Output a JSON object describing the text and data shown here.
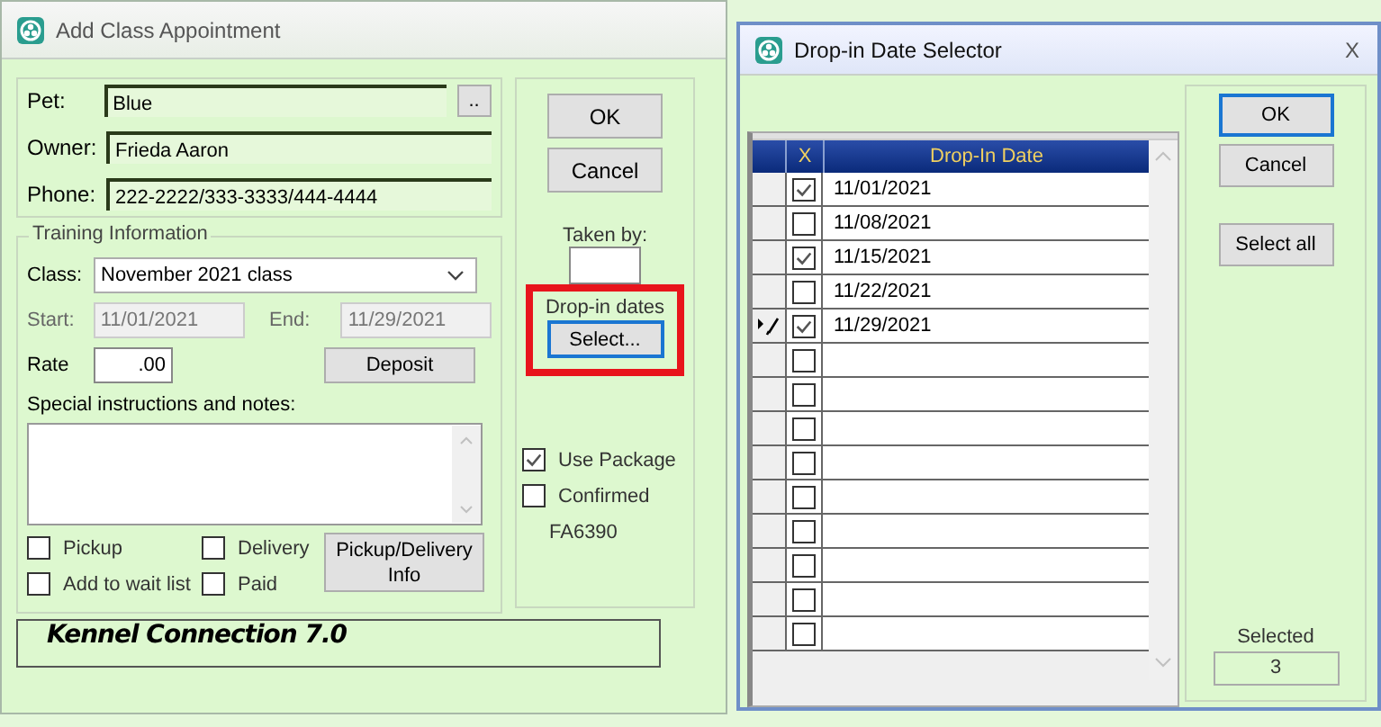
{
  "appointment_window": {
    "title": "Add Class Appointment",
    "owner_info": [
      {
        "label": "Pet:",
        "value": "Blue",
        "browse": ".."
      },
      {
        "label": "Owner:",
        "value": "Frieda Aaron"
      },
      {
        "label": "Phone:",
        "value": "222-2222/333-3333/444-4444"
      }
    ],
    "training": {
      "legend": "Training Information",
      "class_label": "Class:",
      "class_value": "November 2021 class",
      "start_label": "Start:",
      "start_value": "11/01/2021",
      "end_label": "End:",
      "end_value": "11/29/2021",
      "rate_label": "Rate",
      "rate_value": ".00",
      "deposit_button": "Deposit",
      "notes_label": "Special instructions and notes:",
      "checkboxes": [
        {
          "label": "Pickup",
          "checked": false
        },
        {
          "label": "Delivery",
          "checked": false
        },
        {
          "label": "Add to wait list",
          "checked": false
        },
        {
          "label": "Paid",
          "checked": false
        }
      ],
      "pickup_button": "Pickup/Delivery Info"
    },
    "buttons": [
      "OK",
      "Cancel"
    ],
    "taken_by_label": "Taken by:",
    "dropin": {
      "label": "Drop-in dates",
      "button": "Select...",
      "highlighted": true,
      "focused": true
    },
    "options": [
      {
        "label": "Use Package",
        "checked": true
      },
      {
        "label": "Confirmed",
        "checked": false
      }
    ],
    "code": "FA6390",
    "banner": "Kennel Connection 7.0"
  },
  "selector_window": {
    "title": "Drop-in Date Selector",
    "close": "X",
    "columns": [
      "X",
      "Drop-In Date"
    ],
    "rows": [
      {
        "checked": true,
        "date": "11/01/2021",
        "current": false
      },
      {
        "checked": false,
        "date": "11/08/2021",
        "current": false
      },
      {
        "checked": true,
        "date": "11/15/2021",
        "current": false
      },
      {
        "checked": false,
        "date": "11/22/2021",
        "current": false
      },
      {
        "checked": true,
        "date": "11/29/2021",
        "current": true
      },
      {
        "checked": false,
        "current": false
      },
      {
        "checked": false,
        "current": false
      },
      {
        "checked": false,
        "current": false
      },
      {
        "checked": false,
        "current": false
      },
      {
        "checked": false,
        "current": false
      },
      {
        "checked": false,
        "current": false
      },
      {
        "checked": false,
        "current": false
      },
      {
        "checked": false,
        "current": false
      },
      {
        "checked": false,
        "current": false
      }
    ],
    "buttons": [
      {
        "label": "OK",
        "focused": true
      },
      {
        "label": "Cancel",
        "focused": false
      },
      {
        "label": "Select all",
        "focused": false
      }
    ],
    "selected_label": "Selected",
    "selected_value": "3"
  }
}
